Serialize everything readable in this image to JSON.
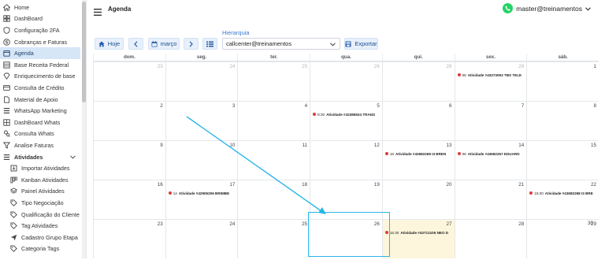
{
  "sidebar": {
    "items": [
      {
        "label": "Home",
        "icon": "home-icon",
        "kind": "top"
      },
      {
        "label": "DashBoard",
        "icon": "dashboard-icon",
        "kind": "top"
      },
      {
        "label": "Configuração 2FA",
        "icon": "shield-icon",
        "kind": "top"
      },
      {
        "label": "Cobranças e Faturas",
        "icon": "dollar-icon",
        "kind": "top"
      },
      {
        "label": "Agenda",
        "icon": "calendar-icon",
        "kind": "active"
      },
      {
        "label": "Base Receita Federal",
        "icon": "table-icon",
        "kind": "top"
      },
      {
        "label": "Enriquecimento de base",
        "icon": "diamond-icon",
        "kind": "top"
      },
      {
        "label": "Consulta de Crédito",
        "icon": "card-icon",
        "kind": "top"
      },
      {
        "label": "Material de Apoio",
        "icon": "document-icon",
        "kind": "top"
      },
      {
        "label": "WhatsApp Marketing",
        "icon": "list-icon",
        "kind": "top"
      },
      {
        "label": "DashBoard Whats",
        "icon": "grid-icon",
        "kind": "top"
      },
      {
        "label": "Consulta Whats",
        "icon": "search-user-icon",
        "kind": "top"
      },
      {
        "label": "Analise Faturas",
        "icon": "filter-icon",
        "kind": "top"
      },
      {
        "label": "Atividades",
        "icon": "list-icon",
        "kind": "group"
      },
      {
        "label": "Importar Atividades",
        "icon": "import-icon",
        "kind": "sub"
      },
      {
        "label": "Kanban Atividades",
        "icon": "kanban-icon",
        "kind": "sub"
      },
      {
        "label": "Painel Atividades",
        "icon": "layers-icon",
        "kind": "sub"
      },
      {
        "label": "Tipo Negociação",
        "icon": "tag-icon",
        "kind": "sub"
      },
      {
        "label": "Qualificação do Cliente",
        "icon": "tag-icon",
        "kind": "sub"
      },
      {
        "label": "Tag Atividades",
        "icon": "tag-icon",
        "kind": "sub"
      },
      {
        "label": "Cadastro Grupo Etapa",
        "icon": "send-icon",
        "kind": "sub"
      },
      {
        "label": "Categoria Tags",
        "icon": "tag-icon",
        "kind": "sub"
      }
    ]
  },
  "header": {
    "title": "Agenda",
    "user": "master@treinamentos"
  },
  "toolbar": {
    "today_label": "Hoje",
    "month_label": "março",
    "hierarchy_label": "Hierarquia",
    "hierarchy_value": "callcenter@treinamentos",
    "export_label": "Exportar"
  },
  "calendar": {
    "weekdays": [
      "dom.",
      "seg.",
      "ter.",
      "qua.",
      "qui.",
      "sex.",
      "sáb."
    ],
    "weeks": [
      [
        {
          "day": "23",
          "muted": true,
          "events": []
        },
        {
          "day": "24",
          "muted": true,
          "events": []
        },
        {
          "day": "25",
          "muted": true,
          "events": []
        },
        {
          "day": "26",
          "muted": true,
          "events": []
        },
        {
          "day": "28",
          "muted": true,
          "events": []
        },
        {
          "day": "29",
          "muted": true,
          "events": [
            {
              "time": "08",
              "text": "Atividade #43373093 TBS TELE"
            }
          ]
        },
        {
          "day": "1",
          "muted": false,
          "events": []
        }
      ],
      [
        {
          "day": "2",
          "muted": false,
          "events": []
        },
        {
          "day": "3",
          "muted": false,
          "events": []
        },
        {
          "day": "4",
          "muted": false,
          "events": []
        },
        {
          "day": "5",
          "muted": false,
          "events": [
            {
              "time": "8:30",
              "text": "Atividade #43386634 TRANS"
            }
          ]
        },
        {
          "day": "6",
          "muted": false,
          "events": []
        },
        {
          "day": "7",
          "muted": false,
          "events": []
        },
        {
          "day": "8",
          "muted": false,
          "events": []
        }
      ],
      [
        {
          "day": "9",
          "muted": false,
          "events": []
        },
        {
          "day": "10",
          "muted": false,
          "events": []
        },
        {
          "day": "11",
          "muted": false,
          "events": []
        },
        {
          "day": "12",
          "muted": false,
          "events": []
        },
        {
          "day": "13",
          "muted": false,
          "events": [
            {
              "time": "18",
              "text": "Atividade #43682268 I3 BREN"
            }
          ]
        },
        {
          "day": "14",
          "muted": false,
          "events": [
            {
              "time": "08",
              "text": "Atividade #43682267 EDUARD"
            }
          ]
        },
        {
          "day": "15",
          "muted": false,
          "events": []
        }
      ],
      [
        {
          "day": "16",
          "muted": false,
          "events": []
        },
        {
          "day": "17",
          "muted": false,
          "events": [
            {
              "time": "14",
              "text": "Atividade #42906206 BRIMBE"
            }
          ]
        },
        {
          "day": "18",
          "muted": false,
          "events": []
        },
        {
          "day": "19",
          "muted": false,
          "events": []
        },
        {
          "day": "20",
          "muted": false,
          "events": []
        },
        {
          "day": "21",
          "muted": false,
          "events": []
        },
        {
          "day": "22",
          "muted": false,
          "events": [
            {
              "time": "15:30",
              "text": "Atividade #43682268 I3 BRE"
            }
          ]
        }
      ],
      [
        {
          "day": "23",
          "muted": false,
          "events": []
        },
        {
          "day": "24",
          "muted": false,
          "events": []
        },
        {
          "day": "25",
          "muted": false,
          "events": []
        },
        {
          "day": "26",
          "muted": false,
          "events": []
        },
        {
          "day": "27",
          "muted": false,
          "today": true,
          "events": [
            {
              "time": "15:30",
              "text": "Atividade #43712105 NEO D"
            }
          ]
        },
        {
          "day": "28",
          "muted": false,
          "events": []
        },
        {
          "day": "29",
          "muted": false,
          "events": []
        }
      ]
    ],
    "extra_day_labels": [
      "30"
    ]
  },
  "colors": {
    "accent": "#29b6e8",
    "active_sidebar": "#d6e6f7",
    "event_dot": "#e03b3b",
    "today_bg": "#fdf6dd",
    "whatsapp": "#25d366"
  }
}
